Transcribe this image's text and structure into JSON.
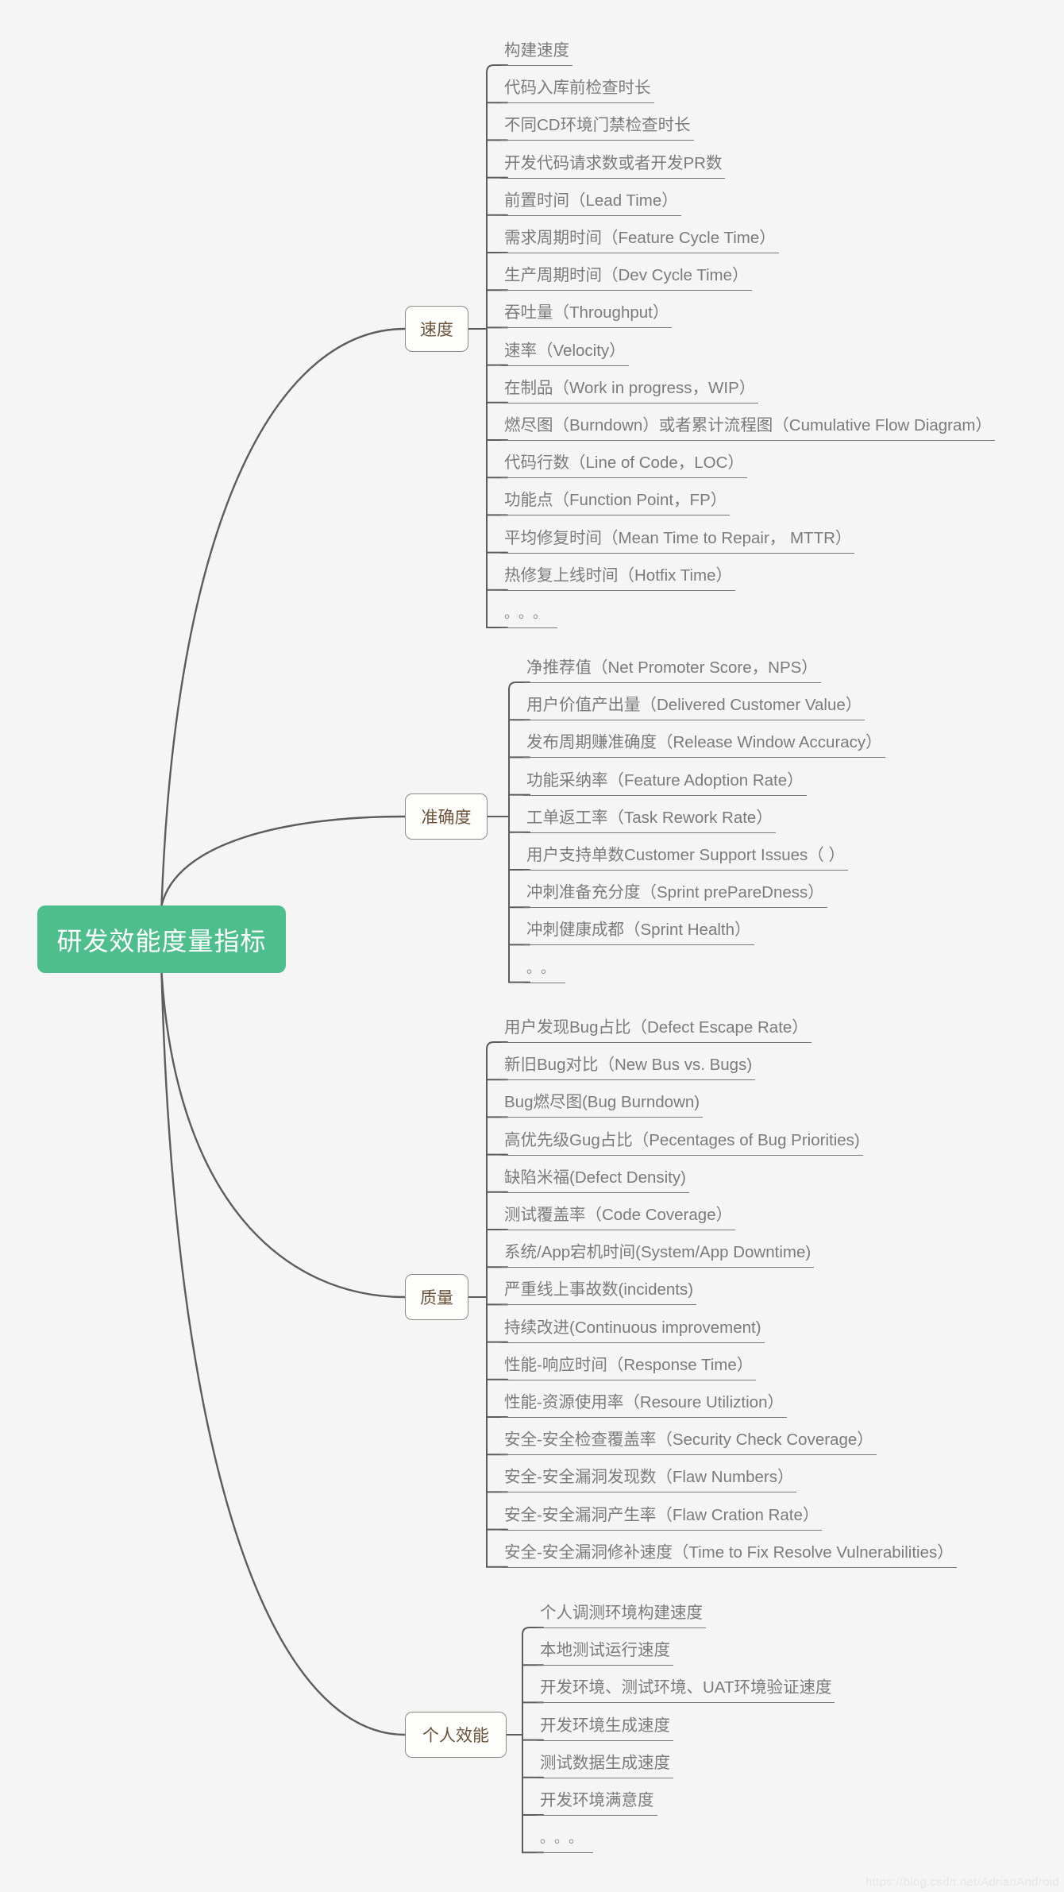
{
  "theme": {
    "background": "#f5f5f5",
    "root_fill": "#4EBE8C",
    "root_text": "#ffffff",
    "branch_fill": "#fdfdfb",
    "branch_border": "#8a8a86",
    "branch_text": "#6b533a",
    "leaf_text": "#7b7b7b",
    "leaf_rule": "#77777a",
    "link_stroke": "#5c5c5c"
  },
  "root": {
    "label": "研发效能度量指标"
  },
  "watermark": {
    "text": "https://blog.csdn.net/AdrianAndroid"
  },
  "branches": [
    {
      "id": "speed",
      "label": "速度",
      "leaves": [
        "构建速度",
        "代码入库前检查时长",
        "不同CD环境门禁检查时长",
        "开发代码请求数或者开发PR数",
        "前置时间（Lead Time）",
        "需求周期时间（Feature Cycle Time）",
        "生产周期时间（Dev Cycle Time）",
        "吞吐量（Throughput）",
        "速率（Velocity）",
        "在制品（Work in progress，WIP）",
        "燃尽图（Burndown）或者累计流程图（Cumulative Flow Diagram）",
        "代码行数（Line of Code，LOC）",
        "功能点（Function Point，FP）",
        "平均修复时间（Mean Time to Repair， MTTR）",
        "热修复上线时间（Hotfix Time）",
        "。。。"
      ]
    },
    {
      "id": "accuracy",
      "label": "准确度",
      "leaves": [
        "净推荐值（Net Promoter Score，NPS）",
        "用户价值产出量（Delivered Customer Value）",
        "发布周期赚准确度（Release Window Accuracy）",
        "功能采纳率（Feature Adoption Rate）",
        "工单返工率（Task Rework Rate）",
        "用户支持单数Customer Support Issues（ ）",
        "冲刺准备充分度（Sprint prePareDness）",
        "冲刺健康成都（Sprint Health）",
        "。。"
      ]
    },
    {
      "id": "quality",
      "label": "质量",
      "leaves": [
        "用户发现Bug占比（Defect Escape Rate）",
        "新旧Bug对比（New Bus vs. Bugs)",
        "Bug燃尽图(Bug Burndown)",
        "高优先级Gug占比（Pecentages of Bug Priorities)",
        "缺陷米福(Defect Density)",
        "测试覆盖率（Code Coverage）",
        "系统/App宕机时间(System/App Downtime)",
        "严重线上事故数(incidents)",
        "持续改进(Continuous improvement)",
        "性能-响应时间（Response Time）",
        "性能-资源使用率（Resoure Utiliztion）",
        "安全-安全检查覆盖率（Security Check Coverage）",
        "安全-安全漏洞发现数（Flaw Numbers）",
        "安全-安全漏洞产生率（Flaw Cration Rate）",
        "安全-安全漏洞修补速度（Time to Fix Resolve Vulnerabilities）"
      ]
    },
    {
      "id": "personal",
      "label": "个人效能",
      "leaves": [
        "个人调测环境构建速度",
        "本地测试运行速度",
        "开发环境、测试环境、UAT环境验证速度",
        "开发环境生成速度",
        "测试数据生成速度",
        "开发环境满意度",
        "。。。"
      ]
    }
  ]
}
